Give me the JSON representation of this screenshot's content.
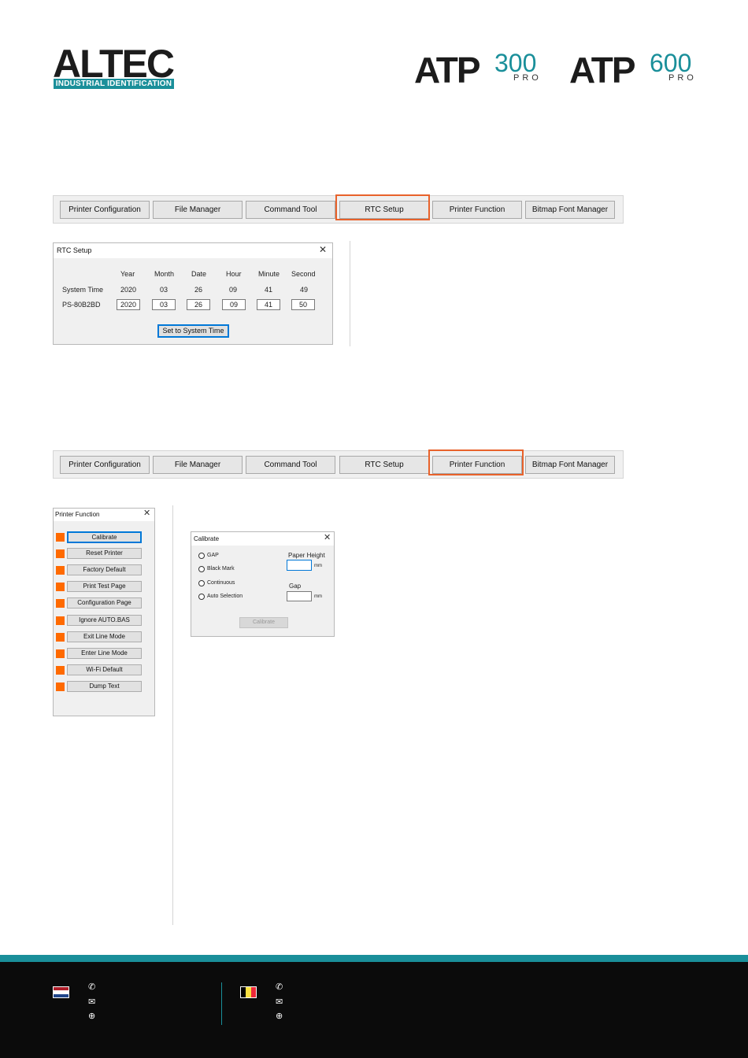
{
  "header": {
    "logo_word": "ALTEC",
    "logo_sub": "INDUSTRIAL IDENTIFICATION",
    "models": [
      {
        "prefix": "ATP",
        "number": "300",
        "suffix": "PRO"
      },
      {
        "prefix": "ATP",
        "number": "600",
        "suffix": "PRO"
      }
    ]
  },
  "tabs": [
    "Printer Configuration",
    "File Manager",
    "Command Tool",
    "RTC Setup",
    "Printer Function",
    "Bitmap Font Manager"
  ],
  "rtc_dialog": {
    "title": "RTC Setup",
    "columns": [
      "Year",
      "Month",
      "Date",
      "Hour",
      "Minute",
      "Second"
    ],
    "system_time_label": "System Time",
    "system_time": [
      "2020",
      "03",
      "26",
      "09",
      "41",
      "49"
    ],
    "device_label": "PS-80B2BD",
    "device_time": [
      "2020",
      "03",
      "26",
      "09",
      "41",
      "50"
    ],
    "button": "Set to System Time"
  },
  "printer_function": {
    "title": "Printer Function",
    "buttons": [
      "Calibrate",
      "Reset Printer",
      "Factory Default",
      "Print Test Page",
      "Configuration Page",
      "Ignore AUTO.BAS",
      "Exit Line Mode",
      "Enter Line Mode",
      "Wi-Fi Default",
      "Dump Text"
    ]
  },
  "calibrate_dialog": {
    "title": "Calibrate",
    "options": [
      "GAP",
      "Black Mark",
      "Continuous",
      "Auto Selection"
    ],
    "paper_height_label": "Paper Height",
    "gap_label": "Gap",
    "unit": "mm",
    "button": "Calibrate"
  },
  "colors": {
    "accent": "#e8622b",
    "brand": "#1a8f9a",
    "footer": "#0b0b0b",
    "status": "#ff6a00"
  },
  "footer_icons": [
    "nl-flag-icon",
    "phone-icon",
    "mail-icon",
    "globe-icon",
    "be-flag-icon"
  ]
}
